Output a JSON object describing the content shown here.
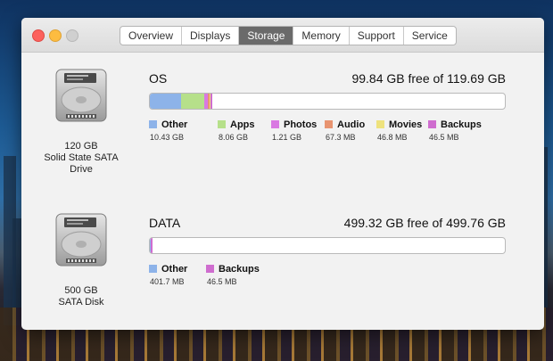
{
  "colors": {
    "other": "#8db3e9",
    "apps": "#b6e08a",
    "photos": "#d979e2",
    "audio": "#e89470",
    "movies": "#eee27d",
    "backups": "#cf6dcf"
  },
  "window": {
    "tabs": [
      {
        "label": "Overview",
        "active": false
      },
      {
        "label": "Displays",
        "active": false
      },
      {
        "label": "Storage",
        "active": true
      },
      {
        "label": "Memory",
        "active": false
      },
      {
        "label": "Support",
        "active": false
      },
      {
        "label": "Service",
        "active": false
      }
    ]
  },
  "drives": [
    {
      "icon": "hard-drive-icon",
      "capacity": "120 GB",
      "type_line1": "Solid State SATA",
      "type_line2": "Drive",
      "volume_name": "OS",
      "free_text": "99.84 GB free of 119.69 GB",
      "segments": [
        {
          "name": "Other",
          "size": "10.43 GB",
          "color": "#8db3e9",
          "fraction": 0.0871
        },
        {
          "name": "Apps",
          "size": "8.06 GB",
          "color": "#b6e08a",
          "fraction": 0.0673
        },
        {
          "name": "Photos",
          "size": "1.21 GB",
          "color": "#d979e2",
          "fraction": 0.0101
        },
        {
          "name": "Audio",
          "size": "67.3 MB",
          "color": "#e89470",
          "fraction": 0.0006
        },
        {
          "name": "Movies",
          "size": "46.8 MB",
          "color": "#eee27d",
          "fraction": 0.0004
        },
        {
          "name": "Backups",
          "size": "46.5 MB",
          "color": "#cf6dcf",
          "fraction": 0.0004
        }
      ]
    },
    {
      "icon": "hard-drive-icon",
      "capacity": "500 GB",
      "type_line1": "SATA Disk",
      "type_line2": "",
      "volume_name": "DATA",
      "free_text": "499.32 GB free of 499.76 GB",
      "segments": [
        {
          "name": "Other",
          "size": "401.7 MB",
          "color": "#8db3e9",
          "fraction": 0.0008
        },
        {
          "name": "Backups",
          "size": "46.5 MB",
          "color": "#cf6dcf",
          "fraction": 0.0001
        }
      ]
    }
  ]
}
